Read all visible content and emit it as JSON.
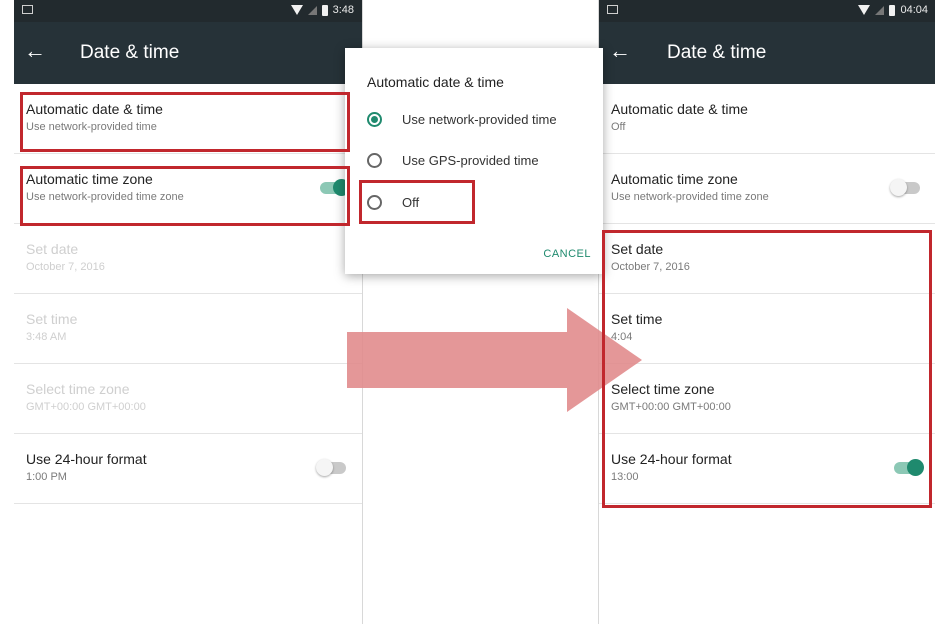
{
  "colors": {
    "toolbar": "#263238",
    "status_bar": "#222a2e",
    "accent": "#1f8a6e",
    "highlight": "#c1272d",
    "arrow": "#e0898a"
  },
  "left_screen": {
    "status_time": "3:48",
    "title": "Date & time",
    "rows": [
      {
        "title": "Automatic date & time",
        "subtitle": "Use network-provided time"
      },
      {
        "title": "Automatic time zone",
        "subtitle": "Use network-provided time zone",
        "switch_on": true
      },
      {
        "title": "Set date",
        "subtitle": "October 7, 2016",
        "disabled": true
      },
      {
        "title": "Set time",
        "subtitle": "3:48 AM",
        "disabled": true
      },
      {
        "title": "Select time zone",
        "subtitle": "GMT+00:00 GMT+00:00",
        "disabled": true
      },
      {
        "title": "Use 24-hour format",
        "subtitle": "1:00 PM",
        "switch_on": false
      }
    ]
  },
  "dialog": {
    "title": "Automatic date & time",
    "options": [
      {
        "label": "Use network-provided time",
        "selected": true
      },
      {
        "label": "Use GPS-provided time",
        "selected": false
      },
      {
        "label": "Off",
        "selected": false
      }
    ],
    "cancel_label": "CANCEL"
  },
  "right_screen": {
    "status_time": "04:04",
    "title": "Date & time",
    "rows": [
      {
        "title": "Automatic date & time",
        "subtitle": "Off"
      },
      {
        "title": "Automatic time zone",
        "subtitle": "Use network-provided time zone",
        "switch_on": false
      },
      {
        "title": "Set date",
        "subtitle": "October 7, 2016"
      },
      {
        "title": "Set time",
        "subtitle": "4:04"
      },
      {
        "title": "Select time zone",
        "subtitle": "GMT+00:00 GMT+00:00"
      },
      {
        "title": "Use 24-hour format",
        "subtitle": "13:00",
        "switch_on": true
      }
    ]
  },
  "icons": {
    "back": "arrow-left-icon",
    "wifi": "wifi-icon",
    "signal": "signal-icon",
    "battery": "battery-icon",
    "notification": "notification-icon",
    "transition_arrow": "right-arrow-icon"
  }
}
